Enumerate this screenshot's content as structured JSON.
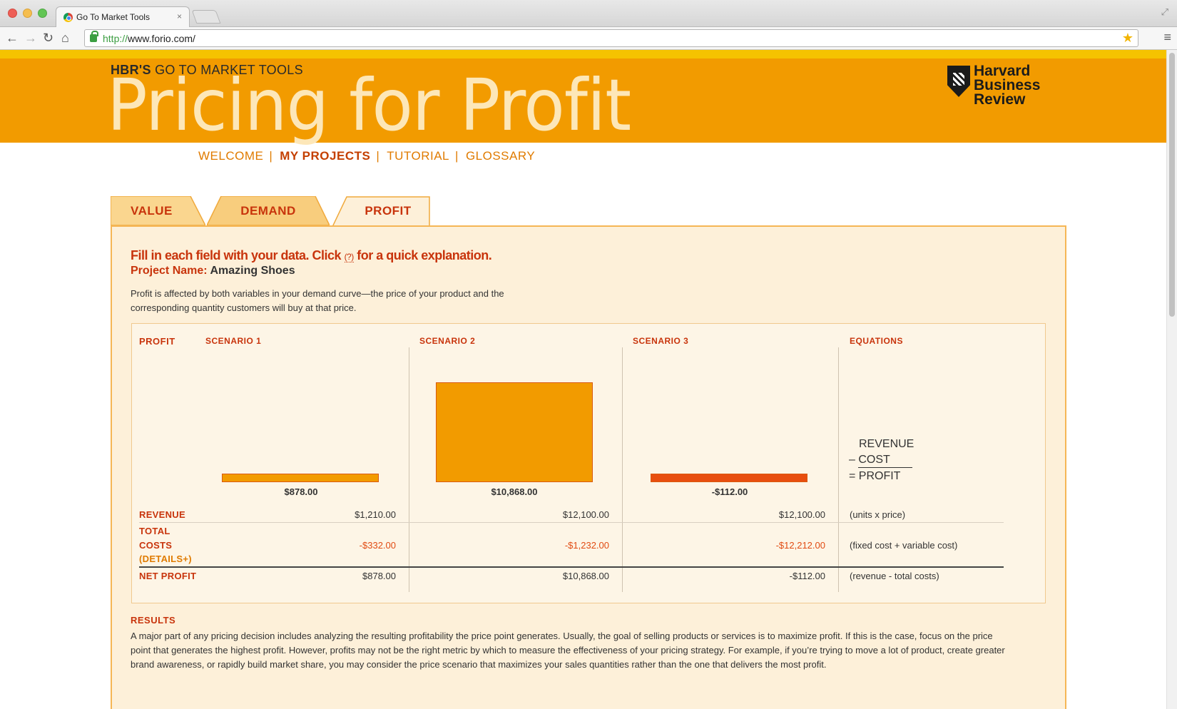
{
  "browser": {
    "tab_title": "Go To Market Tools",
    "tab_close": "×",
    "url_scheme": "http://",
    "url_rest": "www.forio.com/"
  },
  "header": {
    "kicker_bold": "HBR'S",
    "kicker_rest": " GO TO MARKET TOOLS",
    "title": "Pricing for Profit",
    "logo_lines": [
      "Harvard",
      "Business",
      "Review"
    ]
  },
  "nav": {
    "items": [
      {
        "label": "WELCOME"
      },
      {
        "label": "MY PROJECTS"
      },
      {
        "label": "TUTORIAL"
      },
      {
        "label": "GLOSSARY"
      }
    ],
    "separator": "|"
  },
  "tabs": [
    {
      "label": "VALUE"
    },
    {
      "label": "DEMAND"
    },
    {
      "label": "PROFIT"
    }
  ],
  "panel": {
    "instruction_before": "Fill in each field with your data. Click ",
    "instruction_q": "(?)",
    "instruction_after": " for a quick explanation.",
    "project_label": "Project Name:",
    "project_name": "Amazing Shoes",
    "description": "Profit is affected by both variables in your demand curve—the price of your product and the corresponding quantity customers will buy at that price."
  },
  "grid": {
    "headers": {
      "profit": "PROFIT",
      "s1": "SCENARIO 1",
      "s2": "SCENARIO 2",
      "s3": "SCENARIO 3",
      "equations": "EQUATIONS"
    },
    "bar_labels": [
      "$878.00",
      "$10,868.00",
      "-$112.00"
    ],
    "equation": {
      "line1": "REVENUE",
      "line2": "– COST",
      "line3": "= PROFIT"
    },
    "rows": {
      "revenue": {
        "label": "REVENUE",
        "values": [
          "$1,210.00",
          "$12,100.00",
          "$12,100.00"
        ],
        "eq": "(units x price)"
      },
      "costs": {
        "label1": "TOTAL",
        "label2": "COSTS",
        "details": "(DETAILS+)",
        "values": [
          "-$332.00",
          "-$1,232.00",
          "-$12,212.00"
        ],
        "eq": "(fixed cost + variable cost)"
      },
      "net": {
        "label": "NET PROFIT",
        "values": [
          "$878.00",
          "$10,868.00",
          "-$112.00"
        ],
        "eq": "(revenue - total costs)"
      }
    }
  },
  "chart_data": {
    "type": "bar",
    "categories": [
      "SCENARIO 1",
      "SCENARIO 2",
      "SCENARIO 3"
    ],
    "values": [
      878,
      10868,
      -112
    ],
    "title": "PROFIT",
    "colors": [
      "#f29b00",
      "#f29b00",
      "#e84e0f"
    ]
  },
  "results": {
    "heading": "RESULTS",
    "text": "A major part of any pricing decision includes analyzing the resulting profitability the price point generates. Usually, the goal of selling products or services is to maximize profit. If this is the case, focus on the price point that generates the highest profit. However, profits may not be the right metric by which to measure the effectiveness of your pricing strategy. For example, if you’re trying to move a lot of product, create greater brand awareness, or rapidly build market share, you may consider the price scenario that maximizes your sales quantities rather than the one that delivers the most profit."
  },
  "colors": {
    "header_orange": "#f29b00",
    "header_stripe": "#f5c300",
    "accent_red": "#c8340c",
    "panel_bg": "#fdf0d9"
  }
}
